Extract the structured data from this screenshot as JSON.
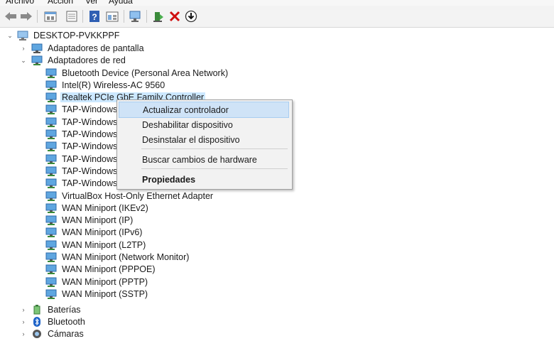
{
  "menu": {
    "file": "Archivo",
    "action": "Acción",
    "view": "Ver",
    "help": "Ayuda"
  },
  "toolbar": {
    "icons": [
      "back-arrow-icon",
      "forward-arrow-icon",
      "properties-icon",
      "view-icon",
      "help-icon",
      "view-devices-icon",
      "scan-hardware-icon",
      "update-driver-icon",
      "uninstall-icon",
      "download-icon"
    ]
  },
  "tree": {
    "root": "DESKTOP-PVKKPPF",
    "display_adapters": "Adaptadores de pantalla",
    "network_adapters": "Adaptadores de red",
    "network_devices": [
      "Bluetooth Device (Personal Area Network)",
      "Intel(R) Wireless-AC 9560",
      "Realtek PCIe GbE Family Controller",
      "TAP-Windows",
      "TAP-Windows",
      "TAP-Windows",
      "TAP-Windows",
      "TAP-Windows",
      "TAP-Windows",
      "TAP-Windows",
      "VirtualBox Host-Only Ethernet Adapter",
      "WAN Miniport (IKEv2)",
      "WAN Miniport (IP)",
      "WAN Miniport (IPv6)",
      "WAN Miniport (L2TP)",
      "WAN Miniport (Network Monitor)",
      "WAN Miniport (PPPOE)",
      "WAN Miniport (PPTP)",
      "WAN Miniport (SSTP)"
    ],
    "batteries": "Baterías",
    "bluetooth": "Bluetooth",
    "cameras": "Cámaras"
  },
  "context_menu": {
    "update_driver": "Actualizar controlador",
    "disable_device": "Deshabilitar dispositivo",
    "uninstall_device": "Desinstalar el dispositivo",
    "scan_hardware": "Buscar cambios de hardware",
    "properties": "Propiedades"
  },
  "colors": {
    "selection": "#cce8ff",
    "highlight": "#cfe3f7",
    "uninstall": "#d01010"
  }
}
